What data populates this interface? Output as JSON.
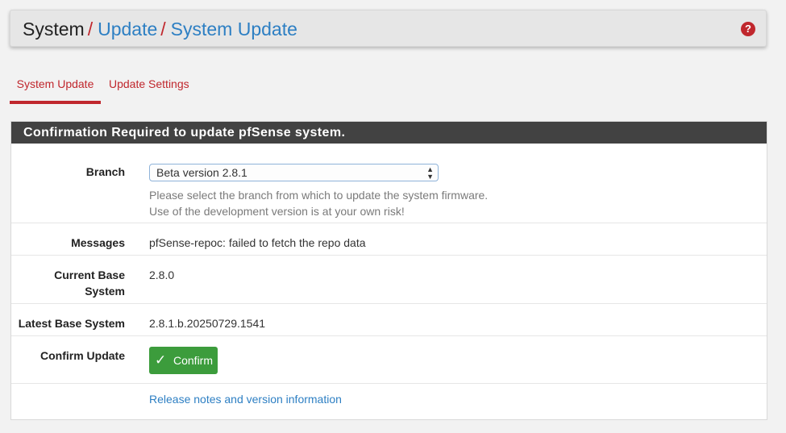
{
  "breadcrumb": {
    "root": "System",
    "separator": "/",
    "level2": "Update",
    "level3": "System Update"
  },
  "help_icon": {
    "glyph": "?",
    "icon": "help-icon"
  },
  "tabs": [
    {
      "label": "System Update",
      "active": true
    },
    {
      "label": "Update Settings",
      "active": false
    }
  ],
  "panel": {
    "title": "Confirmation Required to update pfSense system.",
    "branch": {
      "label": "Branch",
      "selected": "Beta version 2.8.1",
      "help_line1": "Please select the branch from which to update the system firmware.",
      "help_line2": "Use of the development version is at your own risk!"
    },
    "messages": {
      "label": "Messages",
      "value": "pfSense-repoc: failed to fetch the repo data"
    },
    "current_base": {
      "label_line1": "Current Base",
      "label_line2": "System",
      "value": "2.8.0"
    },
    "latest_base": {
      "label": "Latest Base System",
      "value": "2.8.1.b.20250729.1541"
    },
    "confirm": {
      "label": "Confirm Update",
      "button_label": "Confirm",
      "icon": "check-icon"
    },
    "release_notes_link": "Release notes and version information"
  },
  "colors": {
    "accent_red": "#c0272d",
    "link_blue": "#2d7fc3",
    "confirm_green": "#3c9c3c",
    "panel_header": "#424242"
  }
}
